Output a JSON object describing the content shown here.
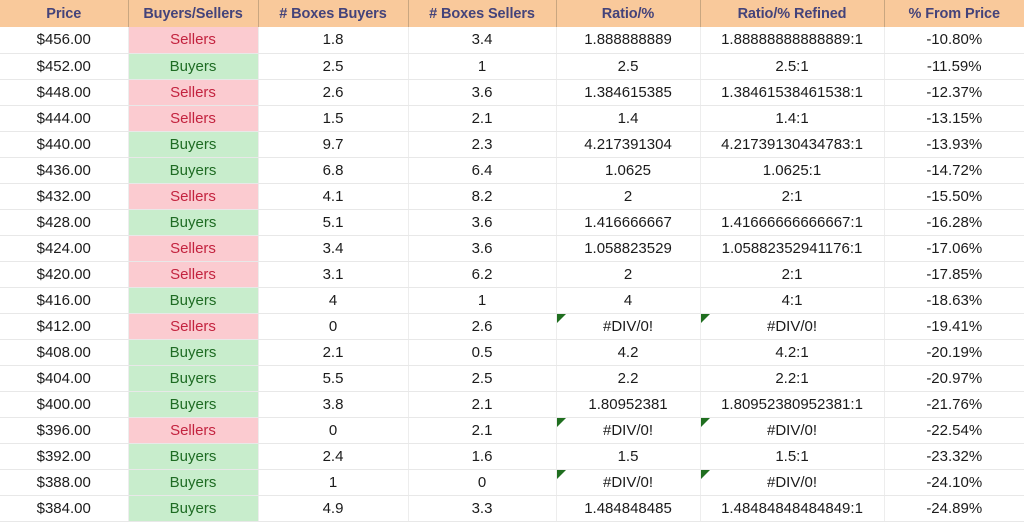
{
  "table": {
    "columns": [
      "Price",
      "Buyers/Sellers",
      "# Boxes Buyers",
      "# Boxes Sellers",
      "Ratio/%",
      "Ratio/% Refined",
      "% From Price"
    ],
    "colors": {
      "header_bg": "#F9C99B",
      "header_text": "#44437A",
      "buyers_bg": "#C8EDCC",
      "buyers_text": "#1E6B23",
      "sellers_bg": "#FBCBD0",
      "sellers_text": "#C3233F",
      "error_flag": "#1F6E1F",
      "grid_line": "#E8E8E8"
    },
    "rows": [
      {
        "price": "$456.00",
        "side": "Sellers",
        "boxes_buyers": "1.8",
        "boxes_sellers": "3.4",
        "ratio": "1.888888889",
        "ratio_refined": "1.88888888888889:1",
        "from_price": "-10.80%",
        "ratio_error": false
      },
      {
        "price": "$452.00",
        "side": "Buyers",
        "boxes_buyers": "2.5",
        "boxes_sellers": "1",
        "ratio": "2.5",
        "ratio_refined": "2.5:1",
        "from_price": "-11.59%",
        "ratio_error": false
      },
      {
        "price": "$448.00",
        "side": "Sellers",
        "boxes_buyers": "2.6",
        "boxes_sellers": "3.6",
        "ratio": "1.384615385",
        "ratio_refined": "1.38461538461538:1",
        "from_price": "-12.37%",
        "ratio_error": false
      },
      {
        "price": "$444.00",
        "side": "Sellers",
        "boxes_buyers": "1.5",
        "boxes_sellers": "2.1",
        "ratio": "1.4",
        "ratio_refined": "1.4:1",
        "from_price": "-13.15%",
        "ratio_error": false
      },
      {
        "price": "$440.00",
        "side": "Buyers",
        "boxes_buyers": "9.7",
        "boxes_sellers": "2.3",
        "ratio": "4.217391304",
        "ratio_refined": "4.21739130434783:1",
        "from_price": "-13.93%",
        "ratio_error": false
      },
      {
        "price": "$436.00",
        "side": "Buyers",
        "boxes_buyers": "6.8",
        "boxes_sellers": "6.4",
        "ratio": "1.0625",
        "ratio_refined": "1.0625:1",
        "from_price": "-14.72%",
        "ratio_error": false
      },
      {
        "price": "$432.00",
        "side": "Sellers",
        "boxes_buyers": "4.1",
        "boxes_sellers": "8.2",
        "ratio": "2",
        "ratio_refined": "2:1",
        "from_price": "-15.50%",
        "ratio_error": false
      },
      {
        "price": "$428.00",
        "side": "Buyers",
        "boxes_buyers": "5.1",
        "boxes_sellers": "3.6",
        "ratio": "1.416666667",
        "ratio_refined": "1.41666666666667:1",
        "from_price": "-16.28%",
        "ratio_error": false
      },
      {
        "price": "$424.00",
        "side": "Sellers",
        "boxes_buyers": "3.4",
        "boxes_sellers": "3.6",
        "ratio": "1.058823529",
        "ratio_refined": "1.05882352941176:1",
        "from_price": "-17.06%",
        "ratio_error": false
      },
      {
        "price": "$420.00",
        "side": "Sellers",
        "boxes_buyers": "3.1",
        "boxes_sellers": "6.2",
        "ratio": "2",
        "ratio_refined": "2:1",
        "from_price": "-17.85%",
        "ratio_error": false
      },
      {
        "price": "$416.00",
        "side": "Buyers",
        "boxes_buyers": "4",
        "boxes_sellers": "1",
        "ratio": "4",
        "ratio_refined": "4:1",
        "from_price": "-18.63%",
        "ratio_error": false
      },
      {
        "price": "$412.00",
        "side": "Sellers",
        "boxes_buyers": "0",
        "boxes_sellers": "2.6",
        "ratio": "#DIV/0!",
        "ratio_refined": "#DIV/0!",
        "from_price": "-19.41%",
        "ratio_error": true
      },
      {
        "price": "$408.00",
        "side": "Buyers",
        "boxes_buyers": "2.1",
        "boxes_sellers": "0.5",
        "ratio": "4.2",
        "ratio_refined": "4.2:1",
        "from_price": "-20.19%",
        "ratio_error": false
      },
      {
        "price": "$404.00",
        "side": "Buyers",
        "boxes_buyers": "5.5",
        "boxes_sellers": "2.5",
        "ratio": "2.2",
        "ratio_refined": "2.2:1",
        "from_price": "-20.97%",
        "ratio_error": false
      },
      {
        "price": "$400.00",
        "side": "Buyers",
        "boxes_buyers": "3.8",
        "boxes_sellers": "2.1",
        "ratio": "1.80952381",
        "ratio_refined": "1.80952380952381:1",
        "from_price": "-21.76%",
        "ratio_error": false
      },
      {
        "price": "$396.00",
        "side": "Sellers",
        "boxes_buyers": "0",
        "boxes_sellers": "2.1",
        "ratio": "#DIV/0!",
        "ratio_refined": "#DIV/0!",
        "from_price": "-22.54%",
        "ratio_error": true
      },
      {
        "price": "$392.00",
        "side": "Buyers",
        "boxes_buyers": "2.4",
        "boxes_sellers": "1.6",
        "ratio": "1.5",
        "ratio_refined": "1.5:1",
        "from_price": "-23.32%",
        "ratio_error": false
      },
      {
        "price": "$388.00",
        "side": "Buyers",
        "boxes_buyers": "1",
        "boxes_sellers": "0",
        "ratio": "#DIV/0!",
        "ratio_refined": "#DIV/0!",
        "from_price": "-24.10%",
        "ratio_error": true
      },
      {
        "price": "$384.00",
        "side": "Buyers",
        "boxes_buyers": "4.9",
        "boxes_sellers": "3.3",
        "ratio": "1.484848485",
        "ratio_refined": "1.48484848484849:1",
        "from_price": "-24.89%",
        "ratio_error": false
      }
    ]
  }
}
